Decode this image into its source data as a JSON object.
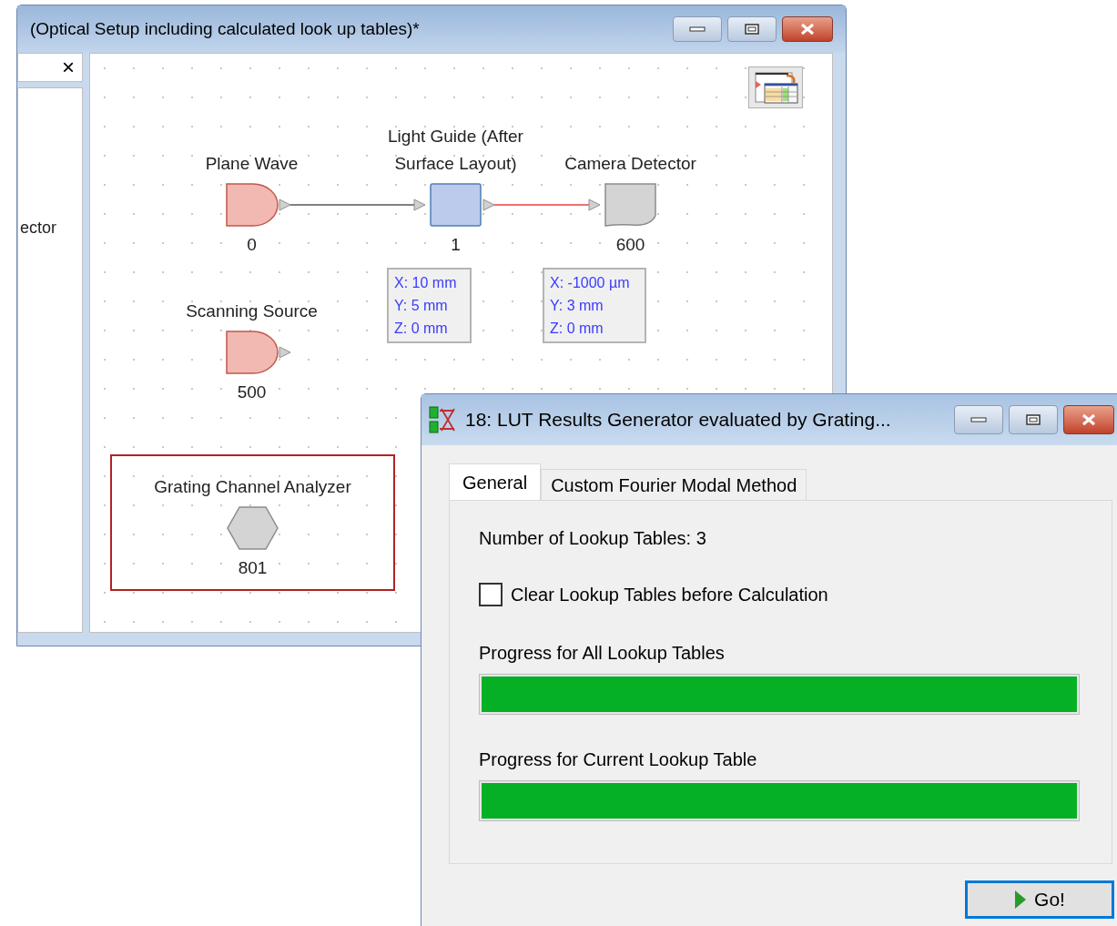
{
  "main_window": {
    "title": "(Optical Setup including calculated look up tables)*",
    "side_panel": {
      "close": "×",
      "label": "ector"
    },
    "diagram": {
      "nodes": [
        {
          "kind": "source",
          "label": "Plane Wave",
          "number": "0",
          "selected": false
        },
        {
          "kind": "component",
          "label": "Light Guide (After Surface Layout)",
          "number": "1",
          "selected": false
        },
        {
          "kind": "detector",
          "label": "Camera Detector",
          "number": "600",
          "selected": false
        },
        {
          "kind": "source",
          "label": "Scanning Source",
          "number": "500",
          "selected": false
        },
        {
          "kind": "analyzer",
          "label": "Grating Channel Analyzer",
          "number": "801",
          "selected": true
        }
      ],
      "connections": [
        {
          "color": "#808080"
        },
        {
          "color": "#f07070"
        }
      ],
      "position_boxes": [
        {
          "lines": [
            "X: 10 mm",
            "Y: 5 mm",
            "Z: 0 mm"
          ]
        },
        {
          "lines": [
            "X: -1000 µm",
            "Y: 3 mm",
            "Z: 0 mm"
          ]
        }
      ]
    }
  },
  "dialog": {
    "title": "18: LUT Results Generator evaluated by Grating...",
    "tabs": [
      {
        "label": "General",
        "selected": true
      },
      {
        "label": "Custom Fourier Modal Method",
        "selected": false
      }
    ],
    "lookup_count": "Number of Lookup Tables: 3",
    "checkbox": {
      "label": "Clear Lookup Tables before Calculation",
      "checked": false
    },
    "progress": [
      {
        "label": "Progress for All Lookup Tables",
        "level": 1
      },
      {
        "label": "Progress for Current Lookup Table",
        "level": 1
      }
    ],
    "go_button": "Go!"
  }
}
